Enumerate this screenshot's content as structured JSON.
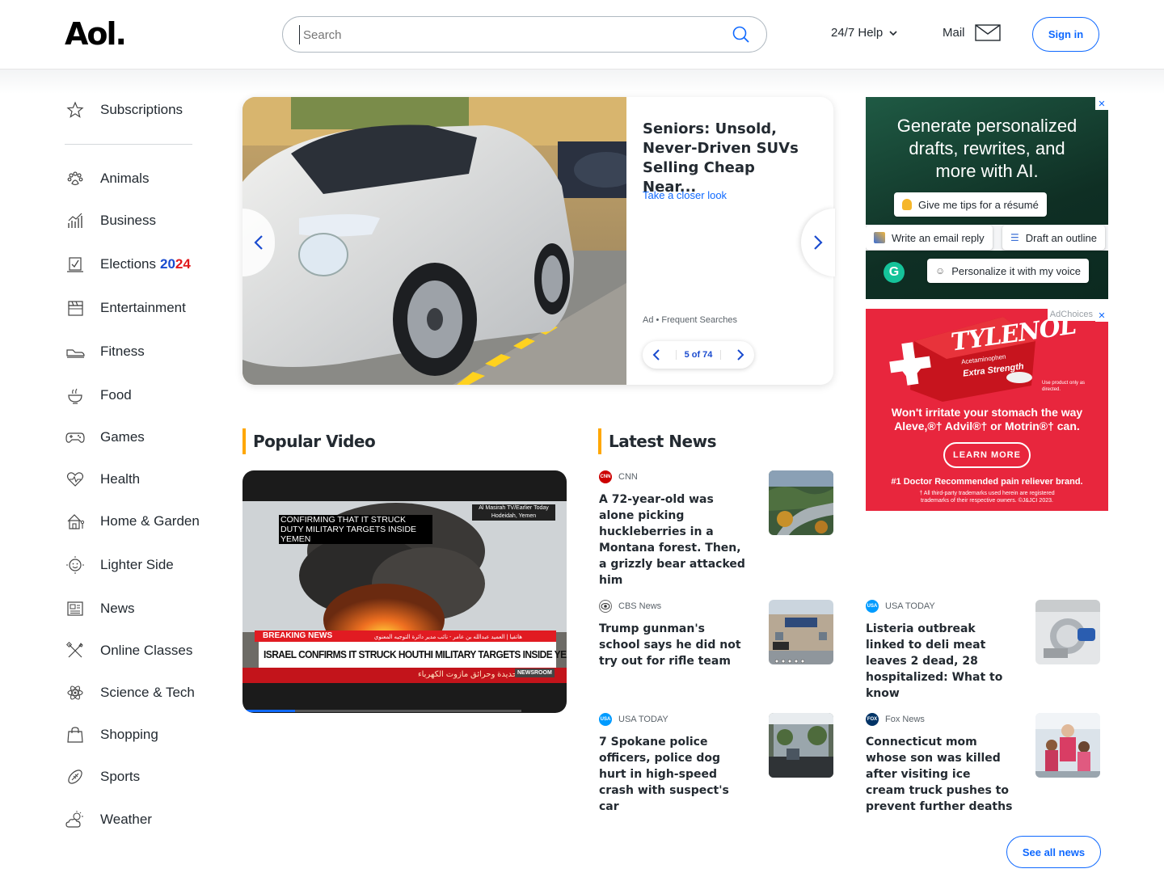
{
  "header": {
    "logo": "Aol.",
    "search_placeholder": "Search",
    "help_label": "24/7 Help",
    "mail_label": "Mail",
    "signin_label": "Sign in"
  },
  "sidebar": {
    "items": [
      {
        "label": "Subscriptions",
        "icon": "star-icon"
      },
      {
        "label": "Animals",
        "icon": "paw-icon"
      },
      {
        "label": "Business",
        "icon": "chart-icon"
      },
      {
        "label": "Elections",
        "suffix_a": "20",
        "suffix_b": "24",
        "icon": "ballot-icon"
      },
      {
        "label": "Entertainment",
        "icon": "clapper-icon"
      },
      {
        "label": "Fitness",
        "icon": "sneaker-icon"
      },
      {
        "label": "Food",
        "icon": "bowl-icon"
      },
      {
        "label": "Games",
        "icon": "gamepad-icon"
      },
      {
        "label": "Health",
        "icon": "heart-icon"
      },
      {
        "label": "Home & Garden",
        "icon": "house-icon"
      },
      {
        "label": "Lighter Side",
        "icon": "smile-icon"
      },
      {
        "label": "News",
        "icon": "newspaper-icon"
      },
      {
        "label": "Online Classes",
        "icon": "pencil-ruler-icon"
      },
      {
        "label": "Science & Tech",
        "icon": "atom-icon"
      },
      {
        "label": "Shopping",
        "icon": "bag-icon"
      },
      {
        "label": "Sports",
        "icon": "football-icon"
      },
      {
        "label": "Weather",
        "icon": "sun-cloud-icon"
      }
    ]
  },
  "hero": {
    "title": "Seniors: Unsold, Never-Driven SUVs Selling Cheap Near...",
    "cta": "Take a closer look",
    "ad_label": "Ad • Frequent Searches",
    "pager": "5 of 74"
  },
  "popular_video": {
    "heading": "Popular Video",
    "caption_top": "CONFIRMING THAT IT STRUCK DUTY MILITARY TARGETS INSIDE YEMEN",
    "tag_line1": "Al Masirah TV/Earlier Today",
    "tag_line2": "Hodeidah, Yemen",
    "breaking": "BREAKING NEWS",
    "arabic_top": "هاتفيا | العميد عبدالله بن عامر - نائب مدير دائرة التوجيه المعنوي",
    "ticker": "ISRAEL CONFIRMS IT STRUCK HOUTHI MILITARY TARGETS INSIDE YEMEN",
    "arabic_bottom": "الحديدة وحرائق مازوت الكهرباء",
    "newsroom": "NEWSROOM"
  },
  "latest_news": {
    "heading": "Latest News",
    "items": [
      {
        "source": "CNN",
        "headline": "A 72-year-old was alone picking huckleberries in a Montana forest. Then, a grizzly bear attacked him"
      },
      {
        "source": "CBS News",
        "headline": "Trump gunman's school says he did not try out for rifle team"
      },
      {
        "source": "USA TODAY",
        "headline": "Listeria outbreak linked to deli meat leaves 2 dead, 28 hospitalized: What to know"
      },
      {
        "source": "USA TODAY",
        "headline": "7 Spokane police officers, police dog hurt in high-speed crash with suspect's car"
      },
      {
        "source": "Fox News",
        "headline": "Connecticut mom whose son was killed after visiting ice cream truck pushes to prevent further deaths"
      }
    ],
    "see_all": "See all news"
  },
  "ad_grammarly": {
    "headline": "Generate personalized drafts, rewrites, and more with AI.",
    "chips": [
      "Give me tips for a résumé",
      "Write an email reply",
      "Draft an outline",
      "Personalize it with my voice"
    ]
  },
  "ad_tylenol": {
    "adchoices": "AdChoices",
    "brand": "TYLENOL",
    "sub1": "Acetaminophen",
    "sub2": "Extra Strength",
    "note": "Use product only as directed.",
    "headline": "Won't irritate your stomach the way Aleve,®† Advil®† or Motrin®† can.",
    "cta": "LEARN MORE",
    "claim": "#1 Doctor Recommended pain reliever brand.",
    "legal": "† All third-party trademarks used herein are registered trademarks of their respective owners. ©J&JCI 2023."
  }
}
